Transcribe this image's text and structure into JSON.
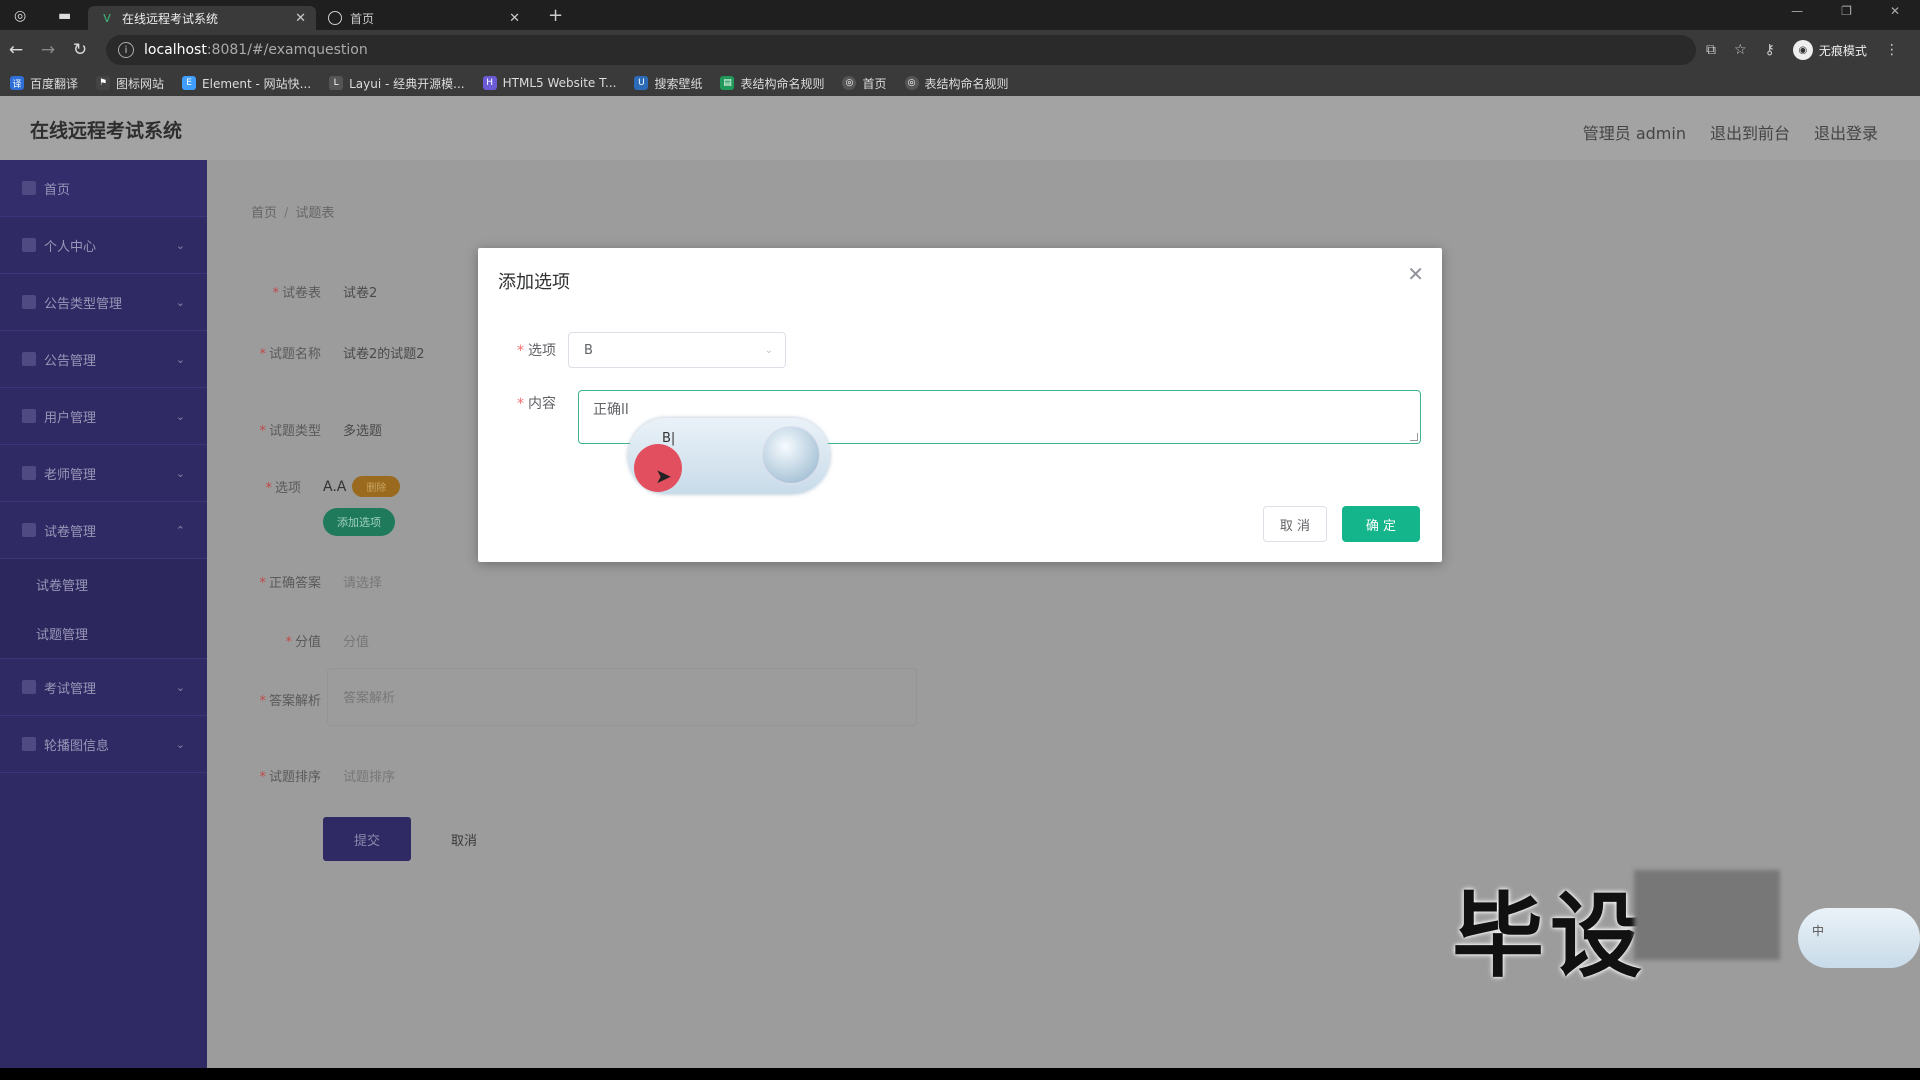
{
  "browser": {
    "tabs": [
      {
        "label": "在线远程考试系统",
        "active": true
      },
      {
        "label": "首页",
        "active": false
      }
    ],
    "url_host": "localhost",
    "url_rest": ":8081/#/examquestion",
    "incognito_label": "无痕模式",
    "bookmarks": [
      "百度翻译",
      "图标网站",
      "Element - 网站快...",
      "Layui - 经典开源模...",
      "HTML5 Website T...",
      "搜索壁纸",
      "表结构命名规则",
      "首页",
      "表结构命名规则"
    ]
  },
  "header": {
    "title": "在线远程考试系统",
    "user": "管理员 admin",
    "back_front": "退出到前台",
    "logout": "退出登录"
  },
  "sidebar": {
    "items": [
      {
        "label": "首页"
      },
      {
        "label": "个人中心"
      },
      {
        "label": "公告类型管理"
      },
      {
        "label": "公告管理"
      },
      {
        "label": "用户管理"
      },
      {
        "label": "老师管理"
      },
      {
        "label": "试卷管理"
      },
      {
        "label": "考试管理"
      },
      {
        "label": "轮播图信息"
      }
    ],
    "subitems": [
      "试卷管理",
      "试题管理"
    ]
  },
  "breadcrumb": {
    "home": "首页",
    "current": "试题表"
  },
  "form": {
    "paper_label": "试卷表",
    "paper_value": "试卷2",
    "name_label": "试题名称",
    "name_value": "试卷2的试题2",
    "type_label": "试题类型",
    "type_value": "多选题",
    "option_label": "选项",
    "option_value": "A.A",
    "option_tag": "删除",
    "add_option": "添加选项",
    "answer_label": "正确答案",
    "answer_placeholder": "请选择",
    "score_label": "分值",
    "score_placeholder": "分值",
    "analysis_label": "答案解析",
    "analysis_placeholder": "答案解析",
    "order_label": "试题排序",
    "order_placeholder": "试题排序",
    "submit": "提交",
    "cancel": "取消"
  },
  "dialog": {
    "title": "添加选项",
    "option_label": "选项",
    "option_value": "B",
    "content_label": "内容",
    "content_value": "正确ll",
    "ime_text": "B|",
    "cancel": "取 消",
    "confirm": "确 定"
  },
  "watermark": {
    "text": "毕设",
    "ime_char": "中"
  }
}
